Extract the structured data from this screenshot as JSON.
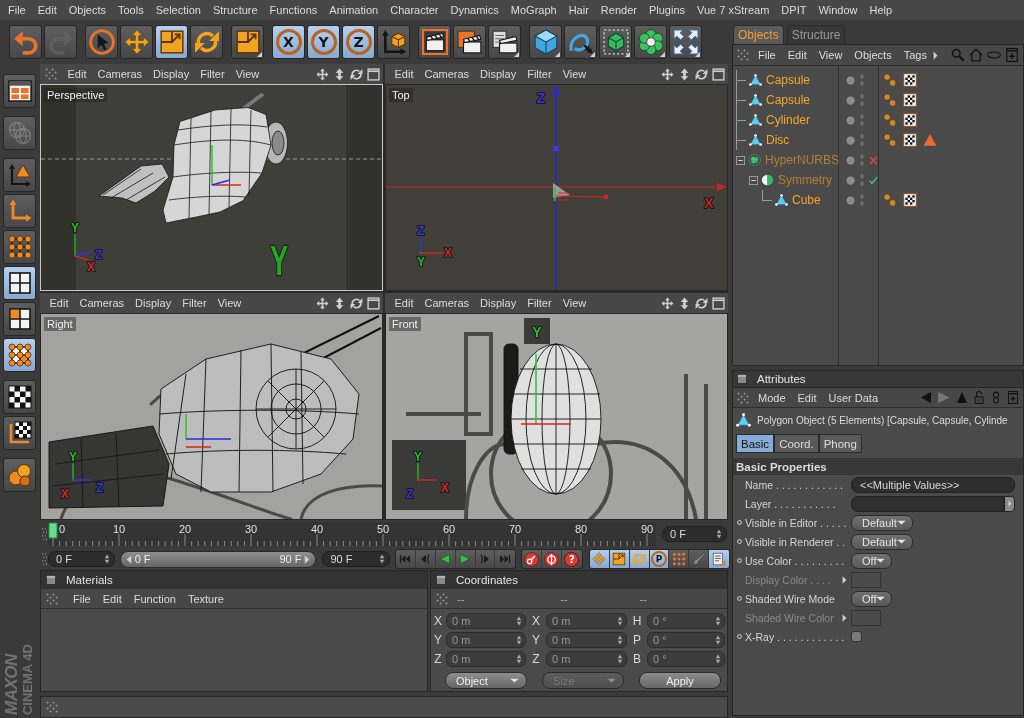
{
  "menu_bar": [
    "File",
    "Edit",
    "Objects",
    "Tools",
    "Selection",
    "Structure",
    "Functions",
    "Animation",
    "Character",
    "Dynamics",
    "MoGraph",
    "Hair",
    "Render",
    "Plugins",
    "Vue 7 xStream",
    "DPIT",
    "Window",
    "Help"
  ],
  "toolbar": [
    [
      {
        "kind": "undo",
        "selected": false,
        "disabled": false,
        "has_menu": false
      },
      {
        "kind": "redo",
        "selected": false,
        "disabled": true,
        "has_menu": false
      }
    ],
    [
      {
        "kind": "select",
        "selected": false,
        "disabled": false,
        "has_menu": false
      },
      {
        "kind": "move",
        "selected": false,
        "disabled": false,
        "has_menu": false
      },
      {
        "kind": "scale",
        "selected": true,
        "disabled": false,
        "has_menu": false
      },
      {
        "kind": "rotate",
        "selected": false,
        "disabled": false,
        "has_menu": false
      }
    ],
    [
      {
        "kind": "scale",
        "selected": false,
        "disabled": false,
        "has_menu": true
      }
    ],
    [
      {
        "kind": "axis",
        "label": "X",
        "selected": true,
        "disabled": false,
        "has_menu": false
      },
      {
        "kind": "axis",
        "label": "Y",
        "selected": true,
        "disabled": false,
        "has_menu": false
      },
      {
        "kind": "axis",
        "label": "Z",
        "selected": true,
        "disabled": false,
        "has_menu": false
      },
      {
        "kind": "coordinates",
        "selected": false,
        "disabled": false,
        "has_menu": false
      }
    ],
    [
      {
        "kind": "render-view",
        "selected": false,
        "disabled": false,
        "has_menu": false
      },
      {
        "kind": "render-picture",
        "selected": false,
        "disabled": false,
        "has_menu": false
      },
      {
        "kind": "render-settings",
        "selected": false,
        "disabled": false,
        "has_menu": true
      }
    ],
    [
      {
        "kind": "cube",
        "selected": false,
        "disabled": false,
        "has_menu": true
      },
      {
        "kind": "spline",
        "selected": false,
        "disabled": false,
        "has_menu": true
      },
      {
        "kind": "nurbs",
        "selected": false,
        "disabled": false,
        "has_menu": true
      },
      {
        "kind": "array",
        "selected": false,
        "disabled": false,
        "has_menu": true
      },
      {
        "kind": "deformer",
        "selected": false,
        "disabled": false,
        "has_menu": true
      }
    ]
  ],
  "side_tools": [
    [
      {
        "kind": "layout",
        "selected": false,
        "disabled": false
      }
    ],
    [
      {
        "kind": "globe",
        "selected": false,
        "disabled": true
      }
    ],
    [
      {
        "kind": "model",
        "selected": false,
        "disabled": false
      },
      {
        "kind": "object-axis",
        "selected": false,
        "disabled": false
      },
      {
        "kind": "points",
        "selected": false,
        "disabled": false
      },
      {
        "kind": "edges",
        "selected": true,
        "disabled": false
      },
      {
        "kind": "polygons",
        "selected": false,
        "disabled": false
      },
      {
        "kind": "point-polygons",
        "selected": true,
        "disabled": false
      }
    ],
    [
      {
        "kind": "texture",
        "selected": false,
        "disabled": false
      },
      {
        "kind": "texture-axis",
        "selected": false,
        "disabled": false
      }
    ],
    [
      {
        "kind": "workplane",
        "selected": false,
        "disabled": false
      }
    ]
  ],
  "logo": {
    "brand": "MAXON",
    "product": "CINEMA 4D"
  },
  "viewports": [
    {
      "label": "Perspective",
      "kind": "perspective",
      "grip": true,
      "active": true,
      "menu": [
        "Edit",
        "Cameras",
        "Display",
        "Filter",
        "View"
      ],
      "gizmo": [
        {
          "text": "Y",
          "color": "#22c022"
        },
        {
          "text": "Z",
          "color": "#3434e0"
        },
        {
          "text": "X",
          "color": "#e02424"
        }
      ],
      "axis_labels": [
        {
          "text": "Y",
          "color": "#22a822"
        }
      ]
    },
    {
      "label": "Top",
      "kind": "top",
      "grip": false,
      "active": false,
      "menu": [
        "Edit",
        "Cameras",
        "Display",
        "Filter",
        "View"
      ],
      "gizmo": [
        {
          "text": "Z",
          "color": "#3434e0"
        },
        {
          "text": "Y",
          "color": "#22c022"
        },
        {
          "text": "X",
          "color": "#e02424"
        }
      ],
      "axis_labels": [
        {
          "text": "Z",
          "color": "#3434e0"
        },
        {
          "text": "X",
          "color": "#c82020"
        }
      ]
    },
    {
      "label": "Right",
      "kind": "right",
      "grip": false,
      "active": false,
      "menu": [
        "Edit",
        "Cameras",
        "Display",
        "Filter",
        "View"
      ],
      "gizmo": [
        {
          "text": "Y",
          "color": "#22c022"
        },
        {
          "text": "X",
          "color": "#e02424"
        },
        {
          "text": "Z",
          "color": "#3434e0"
        }
      ]
    },
    {
      "label": "Front",
      "kind": "front",
      "grip": false,
      "active": false,
      "menu": [
        "Edit",
        "Cameras",
        "Display",
        "Filter",
        "View"
      ],
      "gizmo": [
        {
          "text": "Y",
          "color": "#22c022"
        },
        {
          "text": "Z",
          "color": "#3434e0"
        },
        {
          "text": "X",
          "color": "#e02424"
        }
      ],
      "axis_labels": [
        {
          "text": "Y",
          "color": "#22c022"
        }
      ]
    }
  ],
  "timeline": {
    "frames": [
      "0",
      "10",
      "20",
      "30",
      "40",
      "50",
      "60",
      "70",
      "80",
      "90"
    ],
    "level": 0,
    "current_frame": "0 F"
  },
  "transport": {
    "start": "0 F",
    "range": {
      "start": "0 F",
      "end": "90 F",
      "level": 1
    },
    "end": "90 F",
    "playback": [
      {
        "kind": "first"
      },
      {
        "kind": "previous"
      },
      {
        "kind": "reverse"
      },
      {
        "kind": "play"
      },
      {
        "kind": "next"
      },
      {
        "kind": "last"
      }
    ],
    "record": [
      {
        "kind": "record"
      },
      {
        "kind": "autokey"
      },
      {
        "kind": "help",
        "label": "?"
      }
    ],
    "keys": [
      {
        "kind": "move",
        "selected": true
      },
      {
        "kind": "scale",
        "selected": true
      },
      {
        "kind": "rotate",
        "selected": true
      },
      {
        "kind": "parameter",
        "label": "P",
        "selected": true
      },
      {
        "kind": "dots",
        "selected": false
      },
      {
        "kind": "brush",
        "selected": false
      },
      {
        "kind": "sheet",
        "selected": true
      }
    ]
  },
  "materials": {
    "title": "Materials",
    "menu": [
      "File",
      "Edit",
      "Function",
      "Texture"
    ]
  },
  "coordinates": {
    "title": "Coordinates",
    "columns": [
      "--",
      "--",
      "--"
    ],
    "rows": [
      [
        {
          "axis": "X",
          "value": "0 m"
        },
        {
          "axis": "X",
          "value": "0 m"
        },
        {
          "axis": "H",
          "value": "0 °"
        }
      ],
      [
        {
          "axis": "Y",
          "value": "0 m"
        },
        {
          "axis": "Y",
          "value": "0 m"
        },
        {
          "axis": "P",
          "value": "0 °"
        }
      ],
      [
        {
          "axis": "Z",
          "value": "0 m"
        },
        {
          "axis": "Z",
          "value": "0 m"
        },
        {
          "axis": "B",
          "value": "0 °"
        }
      ]
    ],
    "dropdowns": [
      {
        "value": "Object",
        "disabled": false
      },
      {
        "value": "Size",
        "disabled": true
      }
    ],
    "apply": "Apply"
  },
  "object_manager": {
    "tabs": [
      {
        "label": "Objects",
        "selected": true
      },
      {
        "label": "Structure",
        "selected": false
      }
    ],
    "menu": [
      "File",
      "Edit",
      "View",
      "Objects",
      "Tags"
    ],
    "objects": [
      {
        "name": "Capsule",
        "kind": "polygon",
        "selected": true,
        "tags": [
          {
            "kind": "phong"
          },
          {
            "kind": "texture"
          }
        ]
      },
      {
        "name": "Capsule",
        "kind": "polygon",
        "selected": true,
        "tags": [
          {
            "kind": "phong"
          },
          {
            "kind": "texture"
          }
        ]
      },
      {
        "name": "Cylinder",
        "kind": "polygon",
        "selected": true,
        "tags": [
          {
            "kind": "phong"
          },
          {
            "kind": "texture"
          }
        ]
      },
      {
        "name": "Disc",
        "kind": "polygon",
        "selected": true,
        "tags": [
          {
            "kind": "phong"
          },
          {
            "kind": "texture"
          },
          {
            "kind": "selection"
          }
        ]
      },
      {
        "name": "HyperNURBS",
        "kind": "hypernurbs",
        "selected": false,
        "enabled": false,
        "expanded": true,
        "children": [
          {
            "name": "Symmetry",
            "kind": "symmetry",
            "selected": false,
            "enabled": true,
            "expanded": true,
            "children": [
              {
                "name": "Cube",
                "kind": "polygon",
                "selected": true,
                "tags": [
                  {
                    "kind": "phong"
                  },
                  {
                    "kind": "texture"
                  }
                ]
              }
            ]
          }
        ]
      }
    ]
  },
  "attributes": {
    "title": "Attributes",
    "menu": [
      "Mode",
      "Edit",
      "User Data"
    ],
    "object_title": "Polygon Object (5 Elements) [Capsule, Capsule, Cylinde",
    "tabs": [
      {
        "label": "Basic",
        "selected": true
      },
      {
        "label": "Coord.",
        "selected": false
      },
      {
        "label": "Phong",
        "selected": false
      }
    ],
    "section": "Basic Properties",
    "properties": [
      {
        "label": "Name . . . . . . . . . . . .",
        "kind": "text",
        "value": "<<Multiple Values>>",
        "animatable": false,
        "disabled": false
      },
      {
        "label": "Layer . . . . . . . . . . .",
        "kind": "link",
        "animatable": false,
        "disabled": false
      },
      {
        "label": "Visible in Editor . . . . .",
        "kind": "dropdown",
        "value": "Default",
        "animatable": true,
        "disabled": false
      },
      {
        "label": "Visible in Renderer . .",
        "kind": "dropdown",
        "value": "Default",
        "animatable": true,
        "disabled": false
      },
      {
        "label": "Use Color . . . . . . . . .",
        "kind": "dropdown",
        "value": "Off",
        "animatable": true,
        "disabled": false
      },
      {
        "label": "Display Color . . . .",
        "kind": "color",
        "animatable": false,
        "disabled": true
      },
      {
        "label": "Shaded Wire Mode",
        "kind": "dropdown",
        "value": "Off",
        "animatable": true,
        "disabled": false
      },
      {
        "label": "Shaded Wire Color",
        "kind": "color",
        "animatable": false,
        "disabled": true
      },
      {
        "label": "X-Ray . . . . . . . . . . . .",
        "kind": "checkbox",
        "checked": false,
        "animatable": true,
        "disabled": false
      }
    ]
  }
}
